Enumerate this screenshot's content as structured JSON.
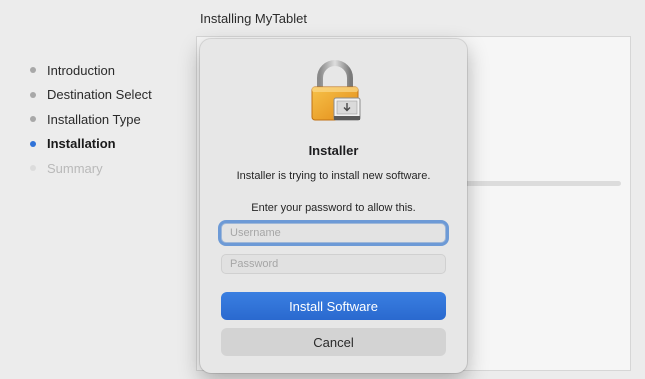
{
  "window": {
    "title": "Installing MyTablet"
  },
  "sidebar": {
    "steps": [
      {
        "label": "Introduction",
        "state": "done"
      },
      {
        "label": "Destination Select",
        "state": "done"
      },
      {
        "label": "Installation Type",
        "state": "done"
      },
      {
        "label": "Installation",
        "state": "current"
      },
      {
        "label": "Summary",
        "state": "disabled"
      }
    ]
  },
  "dialog": {
    "icon": "lock-icon",
    "title": "Installer",
    "message": "Installer is trying to install new software.",
    "prompt": "Enter your password to allow this.",
    "username": {
      "placeholder": "Username",
      "value": ""
    },
    "password": {
      "placeholder": "Password",
      "value": ""
    },
    "primary_button": "Install Software",
    "cancel_button": "Cancel"
  },
  "colors": {
    "accent": "#2f72d8",
    "background": "#ececec",
    "dialog": "#e7e7e7"
  }
}
